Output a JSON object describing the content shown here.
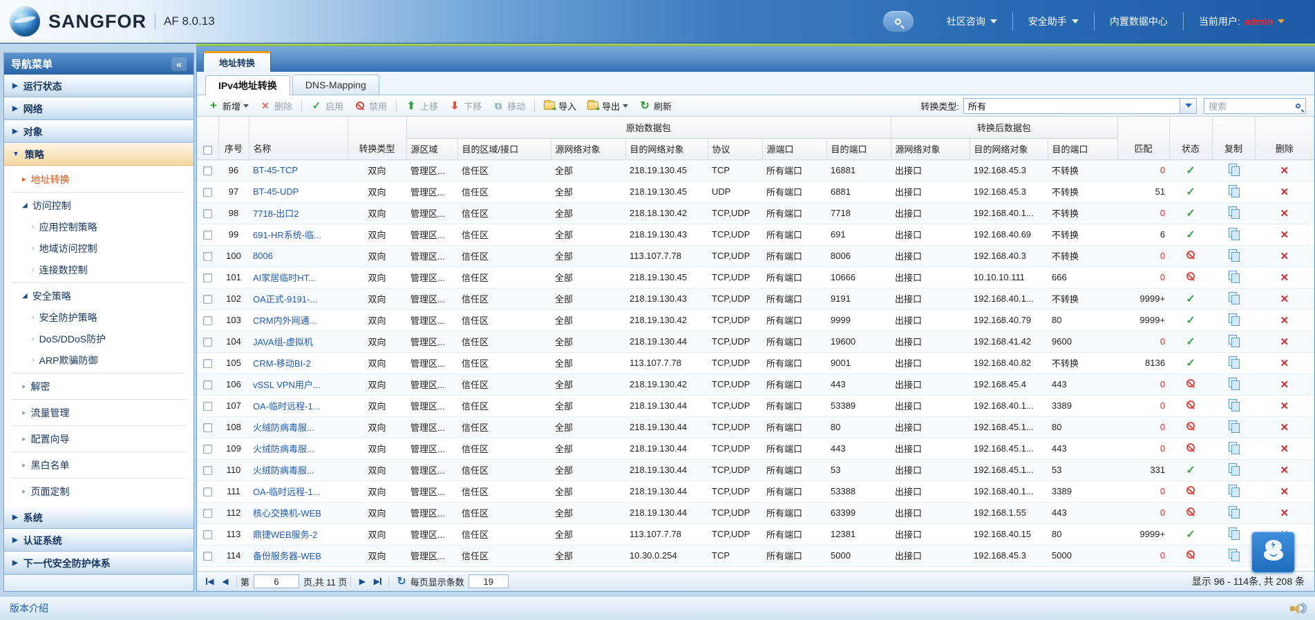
{
  "header": {
    "brand": "SANGFOR",
    "version": "AF 8.0.13",
    "menu": [
      {
        "label": "社区咨询",
        "dropdown": true
      },
      {
        "label": "安全助手",
        "dropdown": true
      },
      {
        "label": "内置数据中心",
        "dropdown": false
      }
    ],
    "user_label": "当前用户:",
    "user_name": "admin"
  },
  "sidebar": {
    "title": "导航菜单",
    "collapse_glyph": "«",
    "groups_top": [
      {
        "label": "运行状态"
      },
      {
        "label": "网络"
      },
      {
        "label": "对象"
      }
    ],
    "expanded_group": "策略",
    "policy_items": [
      {
        "label": "地址转换",
        "level": 1,
        "state": "collapsed",
        "active": true,
        "divider_after": true
      },
      {
        "label": "访问控制",
        "level": 1,
        "state": "expanded"
      },
      {
        "label": "应用控制策略",
        "level": 2
      },
      {
        "label": "地域访问控制",
        "level": 2
      },
      {
        "label": "连接数控制",
        "level": 2,
        "divider_after": true
      },
      {
        "label": "安全策略",
        "level": 1,
        "state": "expanded"
      },
      {
        "label": "安全防护策略",
        "level": 2
      },
      {
        "label": "DoS/DDoS防护",
        "level": 2
      },
      {
        "label": "ARP欺骗防御",
        "level": 2,
        "divider_after": true
      },
      {
        "label": "解密",
        "level": 1,
        "state": "collapsed",
        "divider_after": true
      },
      {
        "label": "流量管理",
        "level": 1,
        "state": "collapsed",
        "divider_after": true
      },
      {
        "label": "配置向导",
        "level": 1,
        "state": "collapsed",
        "divider_after": true
      },
      {
        "label": "黑白名单",
        "level": 1,
        "state": "collapsed",
        "divider_after": true
      },
      {
        "label": "页面定制",
        "level": 1,
        "state": "collapsed"
      }
    ],
    "groups_bottom": [
      {
        "label": "系统"
      },
      {
        "label": "认证系统"
      },
      {
        "label": "下一代安全防护体系"
      }
    ],
    "footer_link": "版本介绍"
  },
  "main": {
    "page_tab": "地址转换",
    "inner_tabs": [
      {
        "label": "IPv4地址转换",
        "active": true
      },
      {
        "label": "DNS-Mapping",
        "active": false
      }
    ],
    "toolbar": {
      "buttons": [
        {
          "label": "新增",
          "icon": "plus",
          "enabled": true,
          "dropdown": true
        },
        {
          "label": "删除",
          "icon": "delete",
          "enabled": false
        },
        {
          "label": "启用",
          "icon": "enable",
          "enabled": false,
          "sep_before": true
        },
        {
          "label": "禁用",
          "icon": "disable",
          "enabled": false
        },
        {
          "label": "上移",
          "icon": "move-up",
          "enabled": false,
          "sep_before": true
        },
        {
          "label": "下移",
          "icon": "move-down",
          "enabled": false
        },
        {
          "label": "移动",
          "icon": "move",
          "enabled": false
        },
        {
          "label": "导入",
          "icon": "import",
          "enabled": true,
          "sep_before": true
        },
        {
          "label": "导出",
          "icon": "export",
          "enabled": true,
          "dropdown": true
        },
        {
          "label": "刷新",
          "icon": "refresh",
          "enabled": true
        }
      ],
      "filter_label": "转换类型:",
      "filter_value": "所有",
      "search_placeholder": "搜索"
    },
    "table": {
      "group_original": "原始数据包",
      "group_translated": "转换后数据包",
      "columns": {
        "no": "序号",
        "name": "名称",
        "type": "转换类型",
        "src_zone": "源区域",
        "dst_zone": "目的区域/接口",
        "src_obj": "源网络对象",
        "dst_obj": "目的网络对象",
        "proto": "协议",
        "src_port": "源端口",
        "dst_port": "目的端口",
        "nat_src_obj": "源网络对象",
        "nat_dst_obj": "目的网络对象",
        "nat_dst_port": "目的端口",
        "match": "匹配",
        "status": "状态",
        "copy": "复制",
        "del": "删除"
      },
      "rows": [
        {
          "no": "96",
          "name": "BT-45-TCP",
          "type": "双向",
          "src_zone": "管理区...",
          "dst_zone": "信任区",
          "src_obj": "全部",
          "dst_obj": "218.19.130.45",
          "proto": "TCP",
          "src_port": "所有端口",
          "dst_port": "16881",
          "nat_src_obj": "出接口",
          "nat_dst_obj": "192.168.45.3",
          "nat_dst_port": "不转换",
          "match": "0",
          "status": "enabled"
        },
        {
          "no": "97",
          "name": "BT-45-UDP",
          "type": "双向",
          "src_zone": "管理区...",
          "dst_zone": "信任区",
          "src_obj": "全部",
          "dst_obj": "218.19.130.45",
          "proto": "UDP",
          "src_port": "所有端口",
          "dst_port": "6881",
          "nat_src_obj": "出接口",
          "nat_dst_obj": "192.168.45.3",
          "nat_dst_port": "不转换",
          "match": "51",
          "status": "enabled"
        },
        {
          "no": "98",
          "name": "7718-出口2",
          "type": "双向",
          "src_zone": "管理区...",
          "dst_zone": "信任区",
          "src_obj": "全部",
          "dst_obj": "218.18.130.42",
          "proto": "TCP,UDP",
          "src_port": "所有端口",
          "dst_port": "7718",
          "nat_src_obj": "出接口",
          "nat_dst_obj": "192.168.40.1...",
          "nat_dst_port": "不转换",
          "match": "0",
          "status": "enabled"
        },
        {
          "no": "99",
          "name": "691-HR系统-临...",
          "type": "双向",
          "src_zone": "管理区...",
          "dst_zone": "信任区",
          "src_obj": "全部",
          "dst_obj": "218.19.130.43",
          "proto": "TCP,UDP",
          "src_port": "所有端口",
          "dst_port": "691",
          "nat_src_obj": "出接口",
          "nat_dst_obj": "192.168.40.69",
          "nat_dst_port": "不转换",
          "match": "6",
          "status": "enabled"
        },
        {
          "no": "100",
          "name": "8006",
          "type": "双向",
          "src_zone": "管理区...",
          "dst_zone": "信任区",
          "src_obj": "全部",
          "dst_obj": "113.107.7.78",
          "proto": "TCP,UDP",
          "src_port": "所有端口",
          "dst_port": "8006",
          "nat_src_obj": "出接口",
          "nat_dst_obj": "192.168.40.3",
          "nat_dst_port": "不转换",
          "match": "0",
          "status": "disabled"
        },
        {
          "no": "101",
          "name": "AI家居临时HT...",
          "type": "双向",
          "src_zone": "管理区...",
          "dst_zone": "信任区",
          "src_obj": "全部",
          "dst_obj": "218.19.130.45",
          "proto": "TCP,UDP",
          "src_port": "所有端口",
          "dst_port": "10666",
          "nat_src_obj": "出接口",
          "nat_dst_obj": "10.10.10.111",
          "nat_dst_port": "666",
          "match": "0",
          "status": "disabled"
        },
        {
          "no": "102",
          "name": "OA正式-9191-...",
          "type": "双向",
          "src_zone": "管理区...",
          "dst_zone": "信任区",
          "src_obj": "全部",
          "dst_obj": "218.19.130.43",
          "proto": "TCP,UDP",
          "src_port": "所有端口",
          "dst_port": "9191",
          "nat_src_obj": "出接口",
          "nat_dst_obj": "192.168.40.1...",
          "nat_dst_port": "不转换",
          "match": "9999+",
          "status": "enabled"
        },
        {
          "no": "103",
          "name": "CRM内外网通...",
          "type": "双向",
          "src_zone": "管理区...",
          "dst_zone": "信任区",
          "src_obj": "全部",
          "dst_obj": "218.19.130.42",
          "proto": "TCP,UDP",
          "src_port": "所有端口",
          "dst_port": "9999",
          "nat_src_obj": "出接口",
          "nat_dst_obj": "192.168.40.79",
          "nat_dst_port": "80",
          "match": "9999+",
          "status": "enabled"
        },
        {
          "no": "104",
          "name": "JAVA组-虚拟机",
          "type": "双向",
          "src_zone": "管理区...",
          "dst_zone": "信任区",
          "src_obj": "全部",
          "dst_obj": "218.19.130.44",
          "proto": "TCP,UDP",
          "src_port": "所有端口",
          "dst_port": "19600",
          "nat_src_obj": "出接口",
          "nat_dst_obj": "192.168.41.42",
          "nat_dst_port": "9600",
          "match": "0",
          "status": "enabled"
        },
        {
          "no": "105",
          "name": "CRM-移动BI-2",
          "type": "双向",
          "src_zone": "管理区...",
          "dst_zone": "信任区",
          "src_obj": "全部",
          "dst_obj": "113.107.7.78",
          "proto": "TCP,UDP",
          "src_port": "所有端口",
          "dst_port": "9001",
          "nat_src_obj": "出接口",
          "nat_dst_obj": "192.168.40.82",
          "nat_dst_port": "不转换",
          "match": "8136",
          "status": "enabled"
        },
        {
          "no": "106",
          "name": "vSSL VPN用户...",
          "type": "双向",
          "src_zone": "管理区...",
          "dst_zone": "信任区",
          "src_obj": "全部",
          "dst_obj": "218.19.130.42",
          "proto": "TCP,UDP",
          "src_port": "所有端口",
          "dst_port": "443",
          "nat_src_obj": "出接口",
          "nat_dst_obj": "192.168.45.4",
          "nat_dst_port": "443",
          "match": "0",
          "status": "disabled"
        },
        {
          "no": "107",
          "name": "OA-临时远程-1...",
          "type": "双向",
          "src_zone": "管理区...",
          "dst_zone": "信任区",
          "src_obj": "全部",
          "dst_obj": "218.19.130.44",
          "proto": "TCP,UDP",
          "src_port": "所有端口",
          "dst_port": "53389",
          "nat_src_obj": "出接口",
          "nat_dst_obj": "192.168.40.1...",
          "nat_dst_port": "3389",
          "match": "0",
          "status": "disabled"
        },
        {
          "no": "108",
          "name": "火绒防病毒服...",
          "type": "双向",
          "src_zone": "管理区...",
          "dst_zone": "信任区",
          "src_obj": "全部",
          "dst_obj": "218.19.130.44",
          "proto": "TCP,UDP",
          "src_port": "所有端口",
          "dst_port": "80",
          "nat_src_obj": "出接口",
          "nat_dst_obj": "192.168.45.1...",
          "nat_dst_port": "80",
          "match": "0",
          "status": "disabled"
        },
        {
          "no": "109",
          "name": "火绒防病毒服...",
          "type": "双向",
          "src_zone": "管理区...",
          "dst_zone": "信任区",
          "src_obj": "全部",
          "dst_obj": "218.19.130.44",
          "proto": "TCP,UDP",
          "src_port": "所有端口",
          "dst_port": "443",
          "nat_src_obj": "出接口",
          "nat_dst_obj": "192.168.45.1...",
          "nat_dst_port": "443",
          "match": "0",
          "status": "disabled"
        },
        {
          "no": "110",
          "name": "火绒防病毒服...",
          "type": "双向",
          "src_zone": "管理区...",
          "dst_zone": "信任区",
          "src_obj": "全部",
          "dst_obj": "218.19.130.44",
          "proto": "TCP,UDP",
          "src_port": "所有端口",
          "dst_port": "53",
          "nat_src_obj": "出接口",
          "nat_dst_obj": "192.168.45.1...",
          "nat_dst_port": "53",
          "match": "331",
          "status": "enabled"
        },
        {
          "no": "111",
          "name": "OA-临时远程-1...",
          "type": "双向",
          "src_zone": "管理区...",
          "dst_zone": "信任区",
          "src_obj": "全部",
          "dst_obj": "218.19.130.44",
          "proto": "TCP,UDP",
          "src_port": "所有端口",
          "dst_port": "53388",
          "nat_src_obj": "出接口",
          "nat_dst_obj": "192.168.40.1...",
          "nat_dst_port": "3389",
          "match": "0",
          "status": "disabled"
        },
        {
          "no": "112",
          "name": "核心交换机-WEB",
          "type": "双向",
          "src_zone": "管理区...",
          "dst_zone": "信任区",
          "src_obj": "全部",
          "dst_obj": "218.19.130.44",
          "proto": "TCP,UDP",
          "src_port": "所有端口",
          "dst_port": "63399",
          "nat_src_obj": "出接口",
          "nat_dst_obj": "192.168.1.55",
          "nat_dst_port": "443",
          "match": "0",
          "status": "disabled"
        },
        {
          "no": "113",
          "name": "鼎捷WEB服务-2",
          "type": "双向",
          "src_zone": "管理区...",
          "dst_zone": "信任区",
          "src_obj": "全部",
          "dst_obj": "113.107.7.78",
          "proto": "TCP,UDP",
          "src_port": "所有端口",
          "dst_port": "12381",
          "nat_src_obj": "出接口",
          "nat_dst_obj": "192.168.40.15",
          "nat_dst_port": "80",
          "match": "9999+",
          "status": "enabled"
        },
        {
          "no": "114",
          "name": "备份服务器-WEB",
          "type": "双向",
          "src_zone": "管理区...",
          "dst_zone": "信任区",
          "src_obj": "全部",
          "dst_obj": "10.30.0.254",
          "proto": "TCP",
          "src_port": "所有端口",
          "dst_port": "5000",
          "nat_src_obj": "出接口",
          "nat_dst_obj": "192.168.45.3",
          "nat_dst_port": "5000",
          "match": "0",
          "status": "disabled"
        }
      ]
    },
    "pagination": {
      "page_prefix": "第",
      "page_value": "6",
      "page_suffix": "页,共 11 页",
      "per_page_label": "每页显示条数",
      "per_page_value": "19",
      "summary": "显示 96 - 114条, 共 208 条"
    }
  },
  "colors": {
    "accent_orange": "#f39c12",
    "link_blue": "#1f5bb5",
    "active_menu_red": "#e8500a",
    "status_green": "#3aa544",
    "status_red": "#d94a3f",
    "match_zero_red": "#e02a2a"
  }
}
